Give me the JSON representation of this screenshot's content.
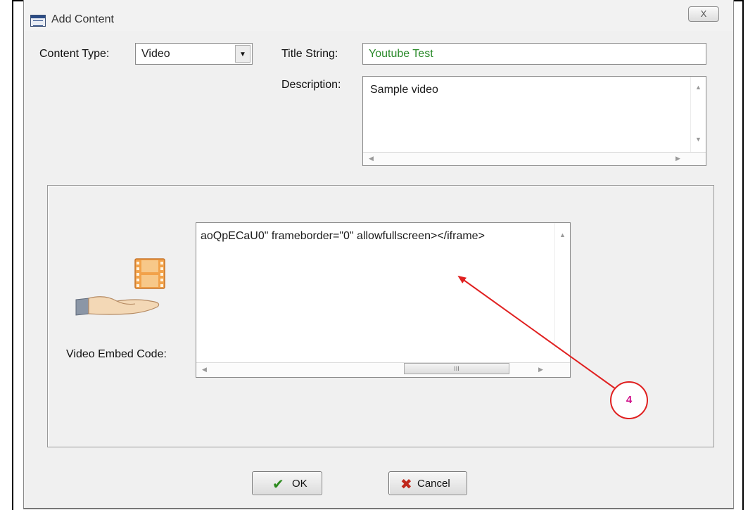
{
  "window": {
    "title": "Add Content",
    "close_glyph": "X"
  },
  "form": {
    "content_type_label": "Content Type:",
    "content_type_value": "Video",
    "title_label": "Title String:",
    "title_value": "Youtube Test",
    "description_label": "Description:",
    "description_value": "Sample video"
  },
  "embed": {
    "label": "Video Embed Code:",
    "value": "aoQpECaU0\" frameborder=\"0\" allowfullscreen></iframe>",
    "scroll_thumb_grip": "III"
  },
  "annotation": {
    "callout_number": "4"
  },
  "buttons": {
    "ok_label": "OK",
    "cancel_label": "Cancel"
  },
  "colors": {
    "title_value_text": "#2a8a2a",
    "annotation_red": "#e02020",
    "ok_check": "#2c8a1e",
    "cancel_x": "#c0281c",
    "dialog_bg": "#f0f0f0"
  },
  "icons": [
    "window-app-icon",
    "close-icon",
    "chevron-down-icon",
    "hand-icon",
    "film-strip-icon",
    "checkmark-icon",
    "x-icon"
  ]
}
